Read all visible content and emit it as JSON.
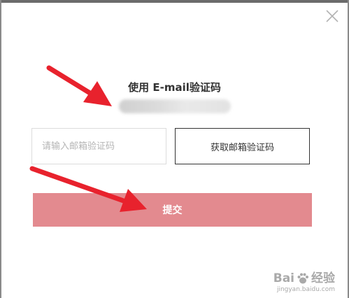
{
  "dialog": {
    "close_icon": "close-icon",
    "title": "使用 E-mail验证码",
    "code_input": {
      "placeholder": "请输入邮箱验证码",
      "value": ""
    },
    "get_code_label": "获取邮箱验证码",
    "submit_label": "提交"
  },
  "colors": {
    "submit_bg": "#e38a8f",
    "arrow": "#e8222d",
    "border_dark": "#333333"
  },
  "watermark": {
    "brand_left": "Bai",
    "brand_right": "经验",
    "url": "jingyan.baidu.com"
  }
}
